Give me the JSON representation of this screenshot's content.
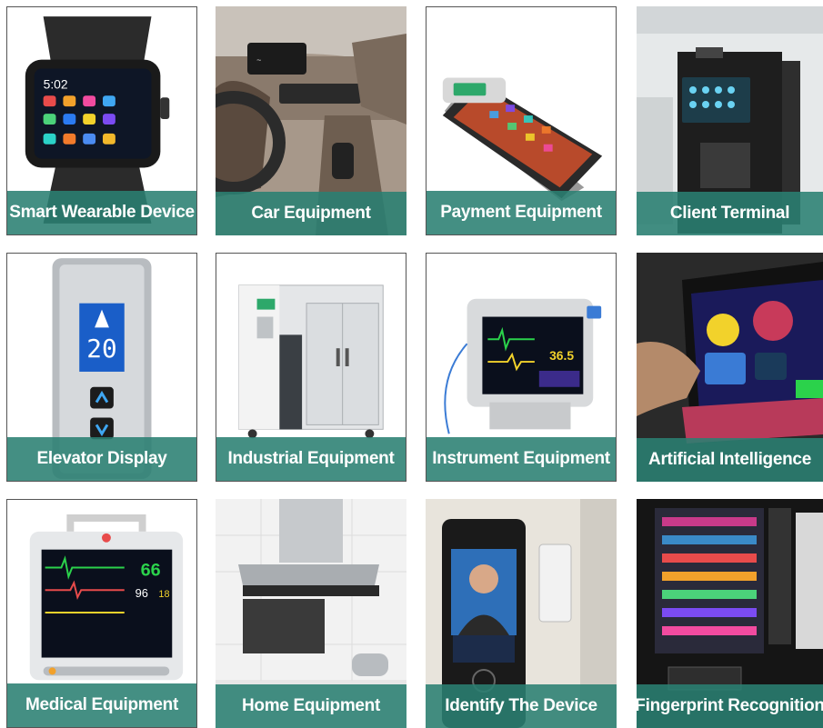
{
  "tiles": [
    {
      "label": "Smart Wearable Device",
      "icon": "smartwatch-photo"
    },
    {
      "label": "Car Equipment",
      "icon": "car-dashboard-photo"
    },
    {
      "label": "Payment Equipment",
      "icon": "payment-terminal-photo"
    },
    {
      "label": "Client Terminal",
      "icon": "kiosk-machine-photo"
    },
    {
      "label": "Elevator Display",
      "icon": "elevator-panel-photo"
    },
    {
      "label": "Industrial Equipment",
      "icon": "industrial-cabinet-photo"
    },
    {
      "label": "Instrument Equipment",
      "icon": "patient-monitor-photo"
    },
    {
      "label": "Artificial Intelligence",
      "icon": "touch-display-photo"
    },
    {
      "label": "Medical Equipment",
      "icon": "medical-monitor-photo"
    },
    {
      "label": "Home Equipment",
      "icon": "range-hood-photo"
    },
    {
      "label": "Identify The Device",
      "icon": "face-recognition-photo"
    },
    {
      "label": "Fingerprint Recognition",
      "icon": "vending-machine-photo"
    }
  ],
  "display_text": {
    "watch_time": "5:02",
    "elevator_floor": "20",
    "monitor_value_a": "36.5",
    "monitor_value_b": "66",
    "monitor_value_c": "96",
    "monitor_value_d": "18"
  }
}
